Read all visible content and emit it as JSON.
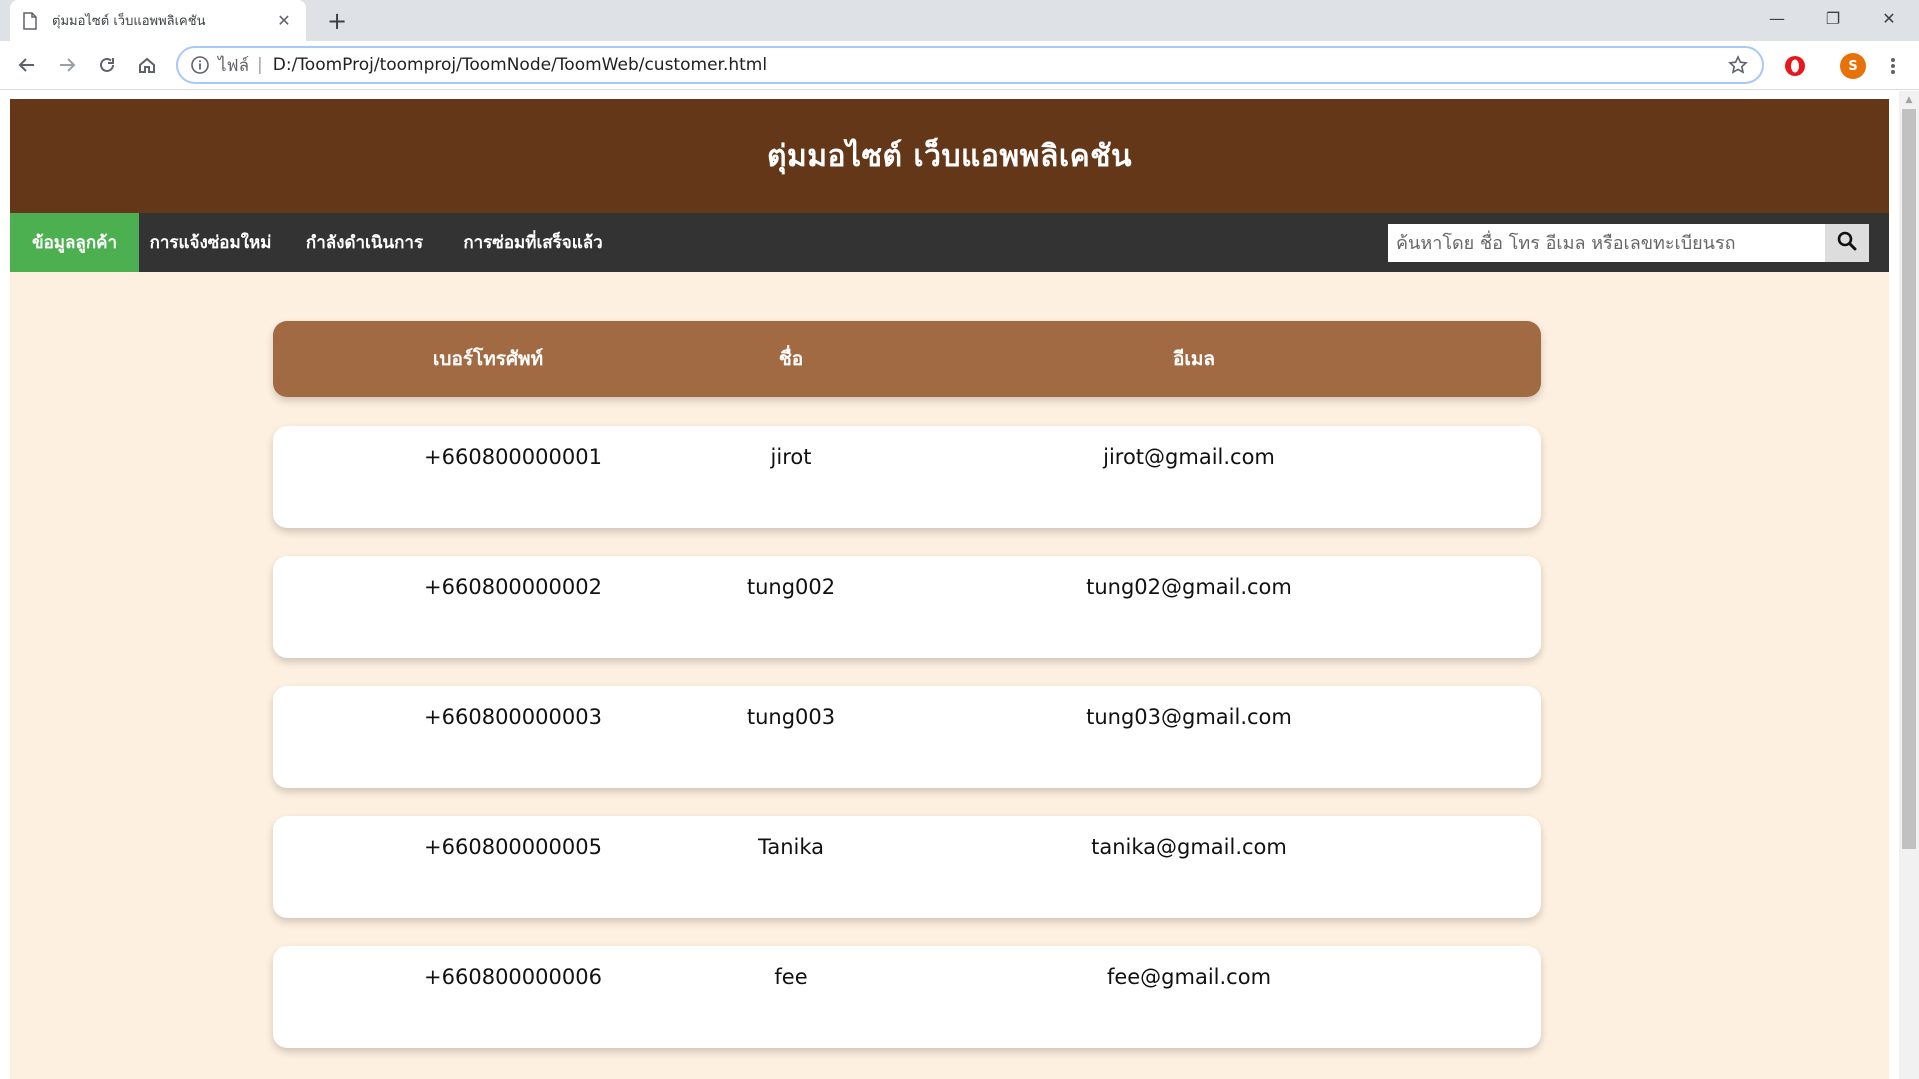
{
  "browser": {
    "tab_title": "ตุ่มมอไซต์ เว็บแอพพลิเคชัน",
    "tab_close": "✕",
    "new_tab": "+",
    "window_controls": {
      "minimize": "—",
      "restore": "❐",
      "close": "✕"
    },
    "address": {
      "scheme_label": "ไฟล์",
      "separator": "|",
      "url": "D:/ToomProj/toomproj/ToomNode/ToomWeb/customer.html"
    },
    "profile_initial": "S",
    "icons": [
      "back-icon",
      "forward-icon",
      "reload-icon",
      "home-icon",
      "info-icon",
      "star-icon",
      "opera-extension-icon",
      "profile-avatar",
      "menu-icon"
    ]
  },
  "site": {
    "title": "ตุ่มมอไซต์ เว็บแอพพลิเคชัน",
    "nav": [
      {
        "label": "ข้อมูลลูกค้า",
        "active": true
      },
      {
        "label": "การแจ้งซ่อมใหม่",
        "active": false
      },
      {
        "label": "กำลังดำเนินการ",
        "active": false
      },
      {
        "label": "การซ่อมที่เสร็จแล้ว",
        "active": false
      }
    ],
    "search_placeholder": "ค้นหาโดย ชื่อ โทร อีเมล หรือเลขทะเบียนรถ"
  },
  "table": {
    "columns": [
      "เบอร์โทรศัพท์",
      "ชื่อ",
      "อีเมล"
    ],
    "rows": [
      {
        "phone": "+660800000001",
        "name": "jirot",
        "email": "jirot@gmail.com"
      },
      {
        "phone": "+660800000002",
        "name": "tung002",
        "email": "tung02@gmail.com"
      },
      {
        "phone": "+660800000003",
        "name": "tung003",
        "email": "tung03@gmail.com"
      },
      {
        "phone": "+660800000005",
        "name": "Tanika",
        "email": "tanika@gmail.com"
      },
      {
        "phone": "+660800000006",
        "name": "fee",
        "email": "fee@gmail.com"
      }
    ]
  },
  "colors": {
    "header_brown": "#633718",
    "nav_dark": "#333333",
    "nav_active_green": "#4caf50",
    "table_head_brown": "#a26a42",
    "page_background": "#fef0e0"
  }
}
